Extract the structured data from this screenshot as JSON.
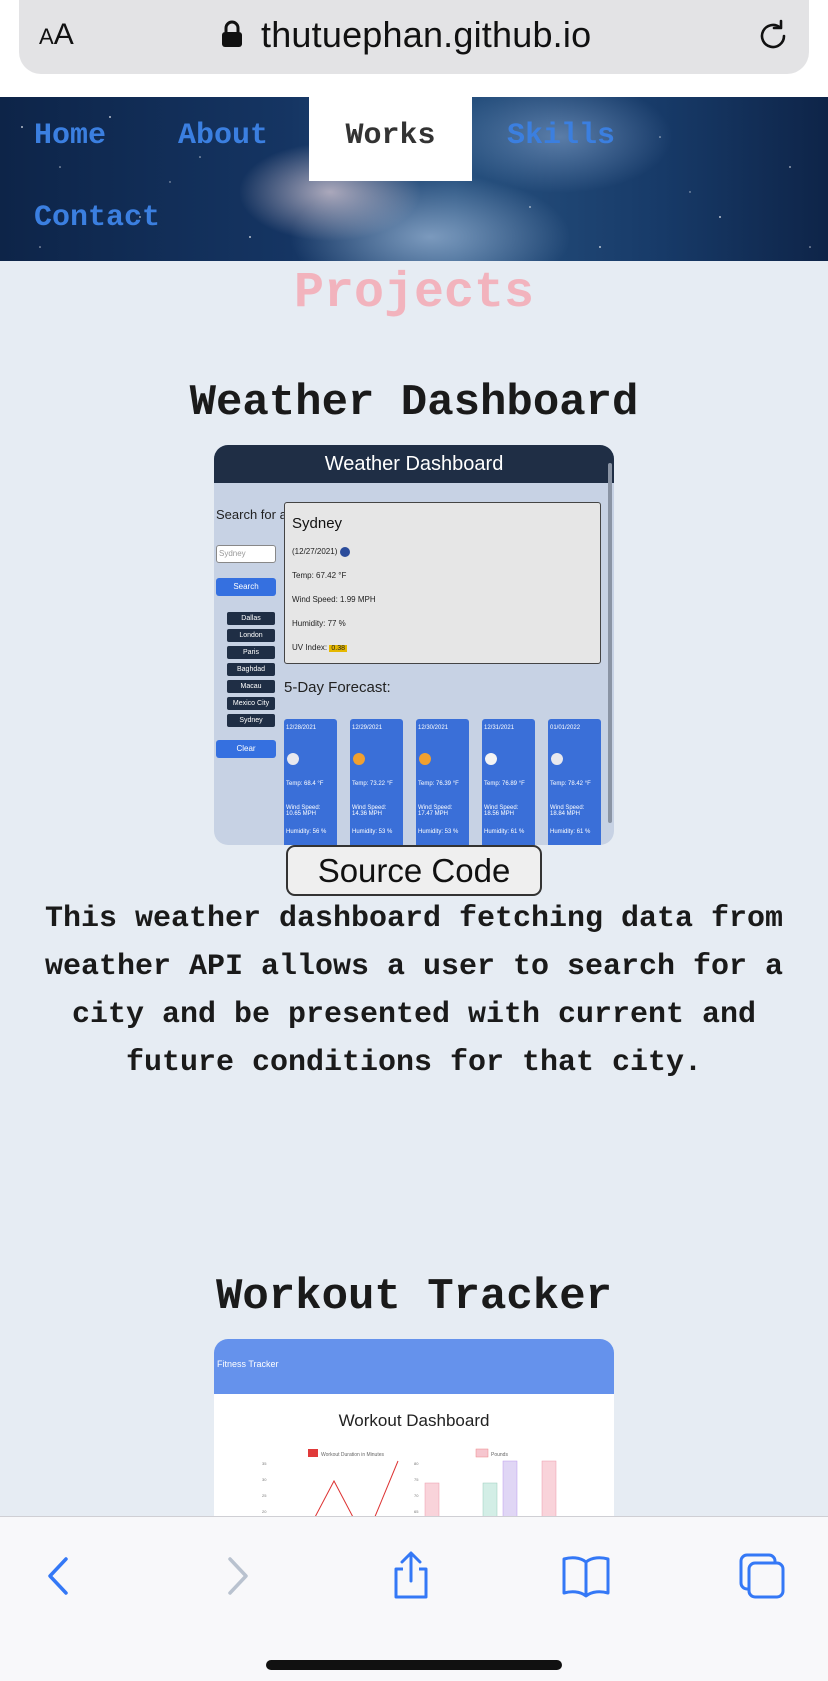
{
  "browser": {
    "text_size_label_small": "A",
    "text_size_label_large": "A",
    "url": "thutuephan.github.io"
  },
  "nav": {
    "items": [
      "Home",
      "About",
      "Works",
      "Skills",
      "Contact"
    ],
    "active": "Works"
  },
  "page": {
    "heading": "Projects"
  },
  "projects": [
    {
      "title": "Weather Dashboard",
      "button": "Source Code",
      "description": "This weather dashboard fetching data from weather API allows a user to search for a city and be presented with current and future conditions for that city.",
      "screenshot": {
        "header": "Weather Dashboard",
        "search_label": "Search for a City:",
        "search_placeholder": "Sydney",
        "search_button": "Search",
        "cities": [
          "Dallas",
          "London",
          "Paris",
          "Baghdad",
          "Macau",
          "Mexico City",
          "Sydney"
        ],
        "clear_button": "Clear",
        "current": {
          "city": "Sydney",
          "date": "(12/27/2021)",
          "temp": "Temp: 67.42 °F",
          "wind": "Wind Speed: 1.99 MPH",
          "humidity": "Humidity: 77 %",
          "uv_label": "UV Index:",
          "uv_value": "0.38"
        },
        "forecast_label": "5-Day Forecast:",
        "forecast": [
          {
            "date": "12/28/2021",
            "temp": "Temp: 68.4 °F",
            "wind": "Wind Speed: 10.65 MPH",
            "humidity": "Humidity: 56 %",
            "icon_color": "#e8e8ee"
          },
          {
            "date": "12/29/2021",
            "temp": "Temp: 73.22 °F",
            "wind": "Wind Speed: 14.36 MPH",
            "humidity": "Humidity: 53 %",
            "icon_color": "#f0a030"
          },
          {
            "date": "12/30/2021",
            "temp": "Temp: 76.39 °F",
            "wind": "Wind Speed: 17.47 MPH",
            "humidity": "Humidity: 53 %",
            "icon_color": "#f0a030"
          },
          {
            "date": "12/31/2021",
            "temp": "Temp: 76.89 °F",
            "wind": "Wind Speed: 18.56 MPH",
            "humidity": "Humidity: 61 %",
            "icon_color": "#f4f4f4"
          },
          {
            "date": "01/01/2022",
            "temp": "Temp: 78.42 °F",
            "wind": "Wind Speed: 18.84 MPH",
            "humidity": "Humidity: 61 %",
            "icon_color": "#e8e8ee"
          }
        ]
      }
    },
    {
      "title": "Workout Tracker",
      "screenshot": {
        "header": "Fitness Tracker",
        "title": "Workout Dashboard",
        "legend_line": "Workout Duration in Minutes",
        "legend_bar": "Pounds",
        "y_ticks_left": [
          "35",
          "30",
          "25",
          "20"
        ],
        "y_ticks_right": [
          "80",
          "75",
          "70",
          "65"
        ]
      }
    }
  ],
  "colors": {
    "nav_link": "#3b7fe0",
    "projects_heading": "#f2b3bd",
    "toolbar_icon": "#3478f6",
    "page_bg": "#e6ecf3"
  },
  "toolbar": {
    "icons": [
      "back-icon",
      "forward-icon",
      "share-icon",
      "bookmarks-icon",
      "tabs-icon"
    ]
  }
}
